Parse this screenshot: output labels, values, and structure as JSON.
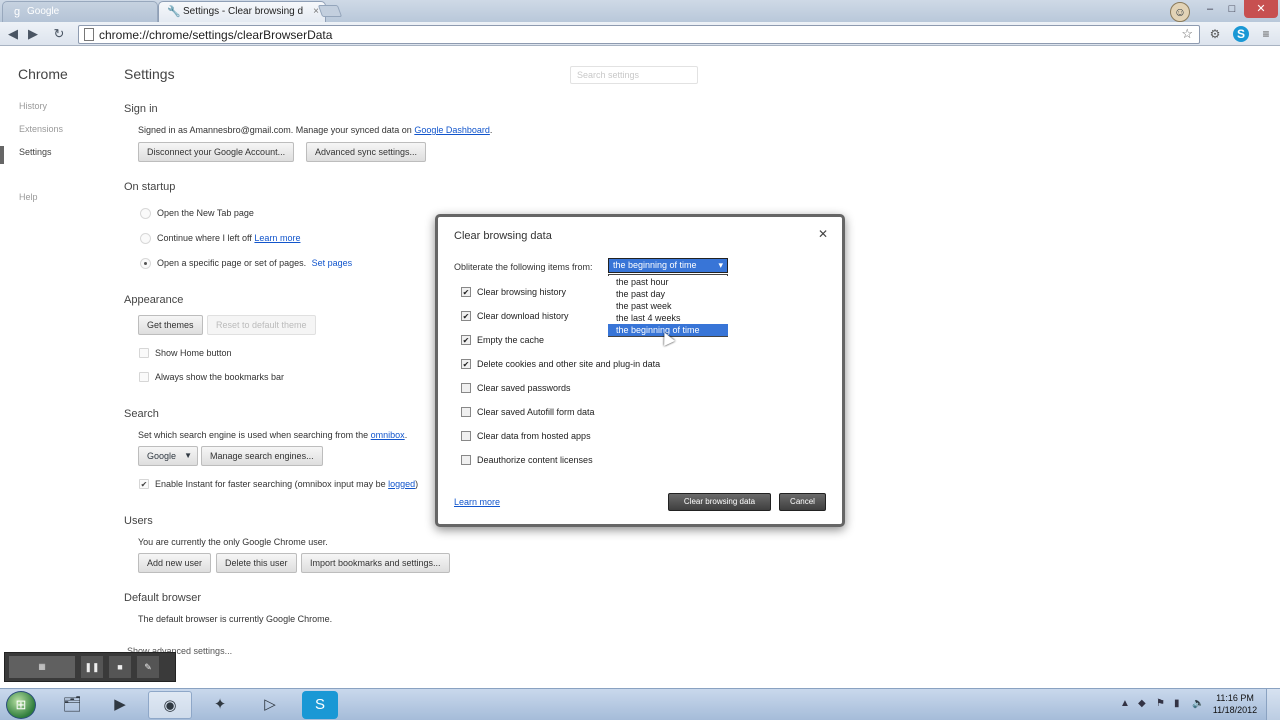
{
  "browser": {
    "tabs": [
      {
        "title": "Google",
        "active": false,
        "icon": "google-icon"
      },
      {
        "title": "Settings - Clear browsing d",
        "active": true,
        "icon": "wrench-icon"
      }
    ],
    "address": "chrome://chrome/settings/clearBrowserData"
  },
  "sidebar": {
    "title": "Chrome",
    "items": [
      {
        "label": "History"
      },
      {
        "label": "Extensions"
      },
      {
        "label": "Settings"
      },
      {
        "label": "Help"
      }
    ]
  },
  "settings": {
    "title": "Settings",
    "search_placeholder": "Search settings",
    "sign_in": {
      "heading": "Sign in",
      "signed_in_text": "Signed in as Amannesbro@gmail.com. Manage your synced data on",
      "dashboard_link": "Google Dashboard",
      "disconnect_button": "Disconnect your Google Account...",
      "advanced_sync_button": "Advanced sync settings..."
    },
    "startup": {
      "heading": "On startup",
      "options": [
        {
          "label": "Open the New Tab page",
          "selected": false
        },
        {
          "label": "Continue where I left off",
          "selected": false,
          "link": "Learn more"
        },
        {
          "label": "Open a specific page or set of pages.",
          "selected": true,
          "link": "Set pages"
        }
      ]
    },
    "appearance": {
      "heading": "Appearance",
      "get_themes_button": "Get themes",
      "reset_theme_button": "Reset to default theme",
      "show_home_button": "Show Home button",
      "bookmarks_bar": "Always show the bookmarks bar"
    },
    "search": {
      "heading": "Search",
      "description": "Set which search engine is used when searching from the",
      "omnibox_link": "omnibox",
      "engine": "Google",
      "manage_button": "Manage search engines...",
      "instant_label": "Enable Instant for faster searching (omnibox input may be",
      "logged_link": "logged"
    },
    "users": {
      "heading": "Users",
      "description": "You are currently the only Google Chrome user.",
      "add_button": "Add new user",
      "delete_button": "Delete this user",
      "import_button": "Import bookmarks and settings..."
    },
    "default_browser": {
      "heading": "Default browser",
      "description": "The default browser is currently Google Chrome."
    },
    "show_advanced": "Show advanced settings..."
  },
  "dialog": {
    "title": "Clear browsing data",
    "obliterate_label": "Obliterate the following items from:",
    "selected_range": "the beginning of time",
    "range_options": [
      "the past hour",
      "the past day",
      "the past week",
      "the last 4 weeks",
      "the beginning of time"
    ],
    "items": [
      {
        "label": "Clear browsing history",
        "checked": true
      },
      {
        "label": "Clear download history",
        "checked": true
      },
      {
        "label": "Empty the cache",
        "checked": true
      },
      {
        "label": "Delete cookies and other site and plug-in data",
        "checked": true
      },
      {
        "label": "Clear saved passwords",
        "checked": false
      },
      {
        "label": "Clear saved Autofill form data",
        "checked": false
      },
      {
        "label": "Clear data from hosted apps",
        "checked": false
      },
      {
        "label": "Deauthorize content licenses",
        "checked": false
      }
    ],
    "learn_more": "Learn more",
    "clear_button": "Clear browsing data",
    "cancel_button": "Cancel"
  },
  "recorder": {
    "buttons": [
      "PAUSE",
      "STOP",
      "DRAW"
    ]
  },
  "taskbar": {
    "time": "11:16 PM",
    "date": "11/18/2012"
  },
  "colors": {
    "accent_selection": "#3875d7",
    "link": "#1155cc",
    "close_button": "#c75050"
  }
}
